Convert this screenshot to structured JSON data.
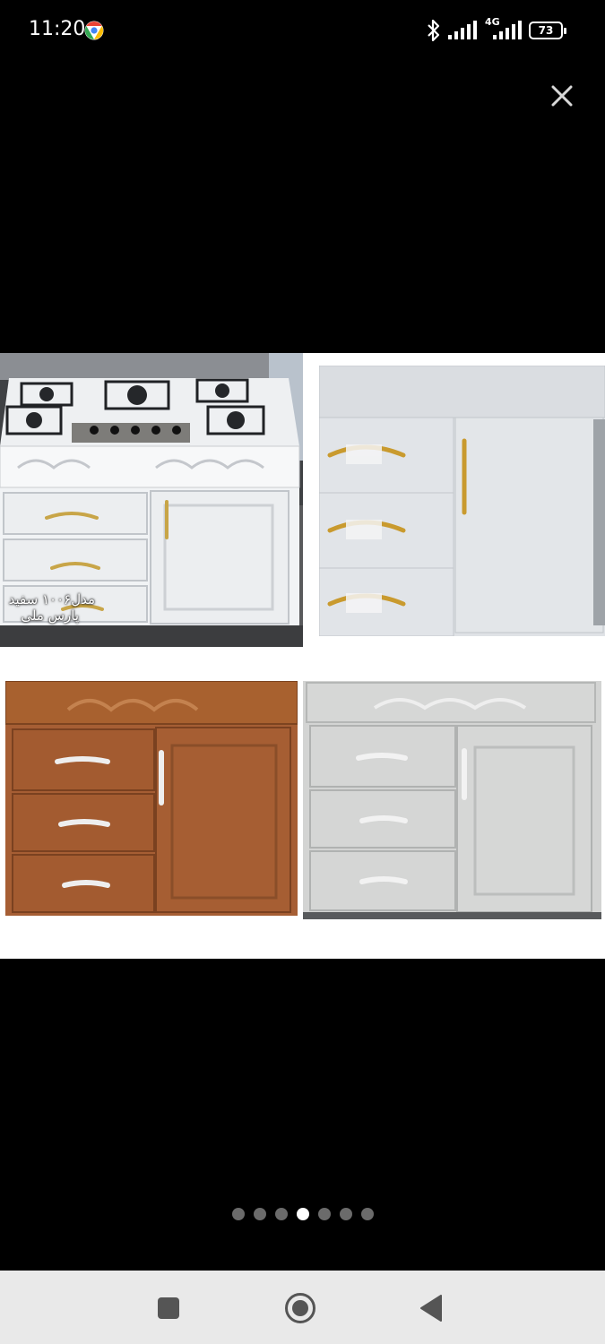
{
  "status_bar": {
    "time": "11:20",
    "network": "4G",
    "battery": "73",
    "battery_percent": 73
  },
  "icons": {
    "browser": "chrome-icon",
    "bluetooth": "bluetooth-icon",
    "signal": "signal-icon",
    "battery": "battery-icon",
    "close": "close-icon"
  },
  "photos": [
    {
      "caption_line1": "مدل۱۰۰۶ سفید",
      "caption_line2": "پارس ملی"
    }
  ],
  "pager": {
    "count": 7,
    "active_index": 3
  },
  "nav_bar": {
    "buttons": [
      "recents",
      "home",
      "back"
    ]
  },
  "colors": {
    "background": "#000000",
    "nav_bar": "#e9e9e9",
    "dot_active": "#ffffff",
    "dot_inactive": "#6b6b6b"
  }
}
